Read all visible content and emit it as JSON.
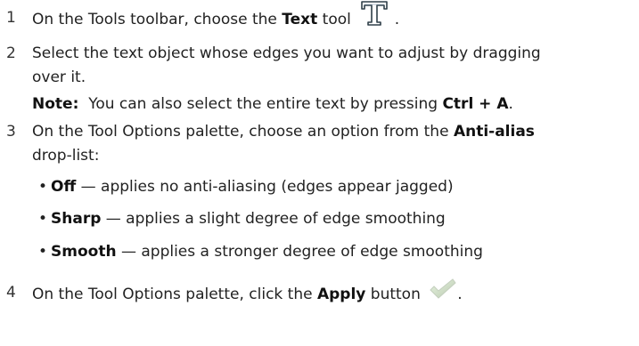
{
  "steps": [
    {
      "number": "1",
      "line1_pre": "On the Tools toolbar, choose the ",
      "line1_bold": "Text",
      "line1_post": " tool",
      "icon": "text-tool-icon"
    },
    {
      "number": "2",
      "line1": "Select the text object whose edges you want to adjust by dragging",
      "line2": "over it.",
      "note_label": "Note:",
      "note_pre": "You can also select the entire text by pressing ",
      "note_key": "Ctrl + A",
      "note_post": "."
    },
    {
      "number": "3",
      "line1_pre": "On the Tool Options palette, choose an option from the ",
      "line1_bold": "Anti-alias",
      "line2": "drop-list:",
      "bullets": [
        {
          "bold": "Off",
          "rest": " — applies no anti-aliasing (edges appear jagged)"
        },
        {
          "bold": "Sharp",
          "rest": " — applies a slight degree of edge smoothing"
        },
        {
          "bold": "Smooth",
          "rest": " — applies a stronger degree of edge smoothing"
        }
      ]
    },
    {
      "number": "4",
      "line1_pre": "On the Tool Options palette, click the ",
      "line1_bold": "Apply",
      "line1_post": " button",
      "icon": "apply-checkmark-icon",
      "line1_end": "."
    }
  ]
}
